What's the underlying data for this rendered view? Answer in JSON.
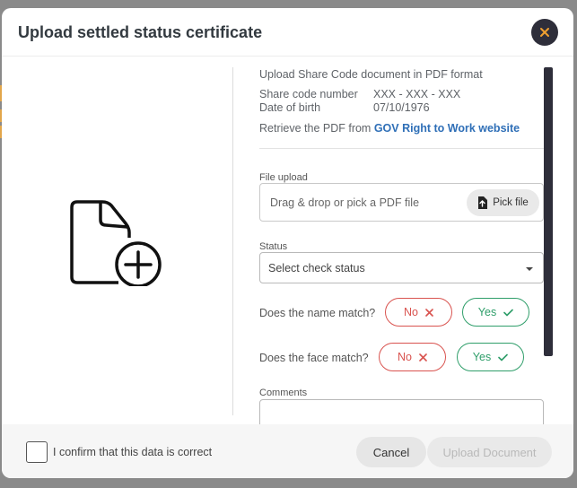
{
  "modal": {
    "title": "Upload settled status certificate"
  },
  "info": {
    "instruction": "Upload Share Code document in PDF format",
    "share_code_label": "Share code number",
    "share_code_value": "XXX - XXX - XXX",
    "dob_label": "Date of birth",
    "dob_value": "07/10/1976",
    "retrieve_text": "Retrieve the PDF from",
    "retrieve_link": "GOV Right to Work website"
  },
  "file_upload": {
    "label": "File upload",
    "placeholder": "Drag & drop or pick a PDF file",
    "pick_label": "Pick file"
  },
  "status": {
    "label": "Status",
    "value": "Select check status"
  },
  "name_match": {
    "question": "Does the name match?",
    "no_label": "No",
    "yes_label": "Yes"
  },
  "face_match": {
    "question": "Does the face match?",
    "no_label": "No",
    "yes_label": "Yes"
  },
  "comments": {
    "label": "Comments"
  },
  "footer": {
    "confirm_label": "I confirm that this data is correct",
    "cancel_label": "Cancel",
    "upload_label": "Upload Document"
  },
  "colors": {
    "accent_orange": "#f0a030",
    "no_red": "#d9534f",
    "yes_green": "#2f9e6a",
    "link_blue": "#2f6fb7",
    "dark": "#2e2e3a"
  },
  "icons": {
    "close": "close-icon",
    "illustration": "file-add-icon",
    "pick_file": "file-upload-icon",
    "select": "chevron-down-icon",
    "no": "x-icon",
    "yes": "check-icon"
  }
}
